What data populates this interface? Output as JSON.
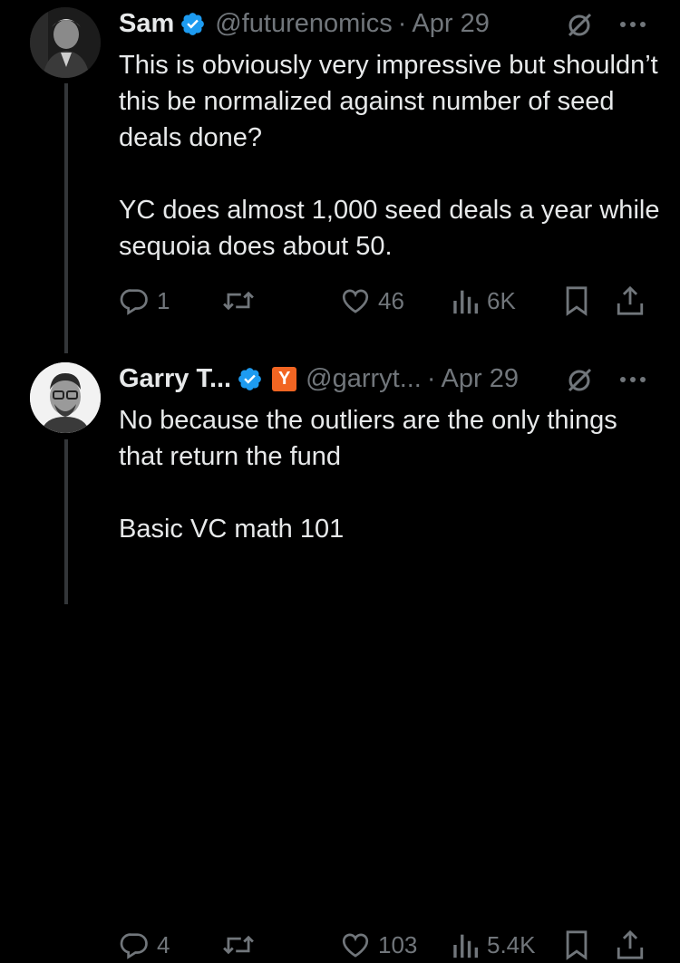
{
  "tweets": [
    {
      "name": "Sam",
      "handle": "@futurenomics",
      "separator": "·",
      "date": "Apr 29",
      "verified": true,
      "body": [
        "This is obviously very impressive but shouldn’t this be normalized against number of seed deals done?",
        "YC does almost 1,000 seed deals a year while sequoia does about 50."
      ],
      "stats": {
        "replies": "1",
        "retweets": "",
        "likes": "46",
        "views": "6K"
      }
    },
    {
      "name": "Garry T...",
      "badge": "Y",
      "handle": "@garryt...",
      "separator": "·",
      "date": "Apr 29",
      "verified": true,
      "body": [
        "No because the outliers are the only things that return the fund",
        "Basic VC math 101"
      ],
      "stats": {
        "replies": "4",
        "retweets": "",
        "likes": "103",
        "views": "5.4K"
      }
    }
  ],
  "colors": {
    "background": "#000000",
    "text": "#e7e9ea",
    "secondary": "#71767b",
    "verified": "#1d9bf0",
    "thread_line": "#333639",
    "yc_badge": "#f26522"
  },
  "icons": [
    "verified-badge-icon",
    "grok-icon",
    "more-icon",
    "reply-icon",
    "retweet-icon",
    "like-icon",
    "views-icon",
    "bookmark-icon",
    "share-icon"
  ]
}
